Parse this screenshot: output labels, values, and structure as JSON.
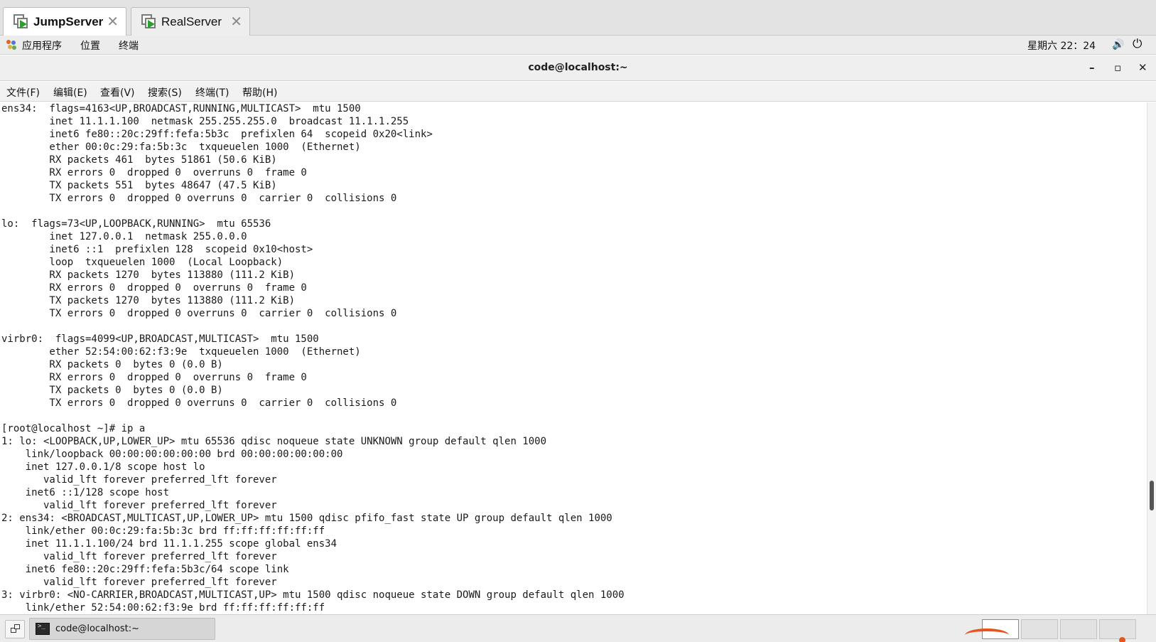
{
  "vm_tabs": [
    {
      "label": "JumpServer",
      "active": true
    },
    {
      "label": "RealServer",
      "active": false
    }
  ],
  "top_panel": {
    "applications": "应用程序",
    "places": "位置",
    "terminal": "终端",
    "clock": "星期六 22：24",
    "volume_icon": "🔊",
    "power_icon": "⏻"
  },
  "window": {
    "title": "code@localhost:~",
    "minimize": "–",
    "maximize": "▫",
    "close": "✕"
  },
  "menubar": {
    "file": "文件(F)",
    "edit": "编辑(E)",
    "view": "查看(V)",
    "search": "搜索(S)",
    "terminal": "终端(T)",
    "help": "帮助(H)"
  },
  "terminal_lines": [
    "ens34:  flags=4163<UP,BROADCAST,RUNNING,MULTICAST>  mtu 1500",
    "        inet 11.1.1.100  netmask 255.255.255.0  broadcast 11.1.1.255",
    "        inet6 fe80::20c:29ff:fefa:5b3c  prefixlen 64  scopeid 0x20<link>",
    "        ether 00:0c:29:fa:5b:3c  txqueuelen 1000  (Ethernet)",
    "        RX packets 461  bytes 51861 (50.6 KiB)",
    "        RX errors 0  dropped 0  overruns 0  frame 0",
    "        TX packets 551  bytes 48647 (47.5 KiB)",
    "        TX errors 0  dropped 0 overruns 0  carrier 0  collisions 0",
    "",
    "lo:  flags=73<UP,LOOPBACK,RUNNING>  mtu 65536",
    "        inet 127.0.0.1  netmask 255.0.0.0",
    "        inet6 ::1  prefixlen 128  scopeid 0x10<host>",
    "        loop  txqueuelen 1000  (Local Loopback)",
    "        RX packets 1270  bytes 113880 (111.2 KiB)",
    "        RX errors 0  dropped 0  overruns 0  frame 0",
    "        TX packets 1270  bytes 113880 (111.2 KiB)",
    "        TX errors 0  dropped 0 overruns 0  carrier 0  collisions 0",
    "",
    "virbr0:  flags=4099<UP,BROADCAST,MULTICAST>  mtu 1500",
    "        ether 52:54:00:62:f3:9e  txqueuelen 1000  (Ethernet)",
    "        RX packets 0  bytes 0 (0.0 B)",
    "        RX errors 0  dropped 0  overruns 0  frame 0",
    "        TX packets 0  bytes 0 (0.0 B)",
    "        TX errors 0  dropped 0 overruns 0  carrier 0  collisions 0",
    "",
    "[root@localhost ~]# ip a",
    "1: lo: <LOOPBACK,UP,LOWER_UP> mtu 65536 qdisc noqueue state UNKNOWN group default qlen 1000",
    "    link/loopback 00:00:00:00:00:00 brd 00:00:00:00:00:00",
    "    inet 127.0.0.1/8 scope host lo",
    "       valid_lft forever preferred_lft forever",
    "    inet6 ::1/128 scope host",
    "       valid_lft forever preferred_lft forever",
    "2: ens34: <BROADCAST,MULTICAST,UP,LOWER_UP> mtu 1500 qdisc pfifo_fast state UP group default qlen 1000",
    "    link/ether 00:0c:29:fa:5b:3c brd ff:ff:ff:ff:ff:ff",
    "    inet 11.1.1.100/24 brd 11.1.1.255 scope global ens34",
    "       valid_lft forever preferred_lft forever",
    "    inet6 fe80::20c:29ff:fefa:5b3c/64 scope link",
    "       valid_lft forever preferred_lft forever",
    "3: virbr0: <NO-CARRIER,BROADCAST,MULTICAST,UP> mtu 1500 qdisc noqueue state DOWN group default qlen 1000",
    "    link/ether 52:54:00:62:f3:9e brd ff:ff:ff:ff:ff:ff"
  ],
  "taskbar": {
    "task_label": "code@localhost:~",
    "workspaces": 4,
    "active_workspace": 1
  },
  "colors": {
    "accent_green": "#2e9e2e",
    "swoosh_orange": "#e8541b"
  }
}
